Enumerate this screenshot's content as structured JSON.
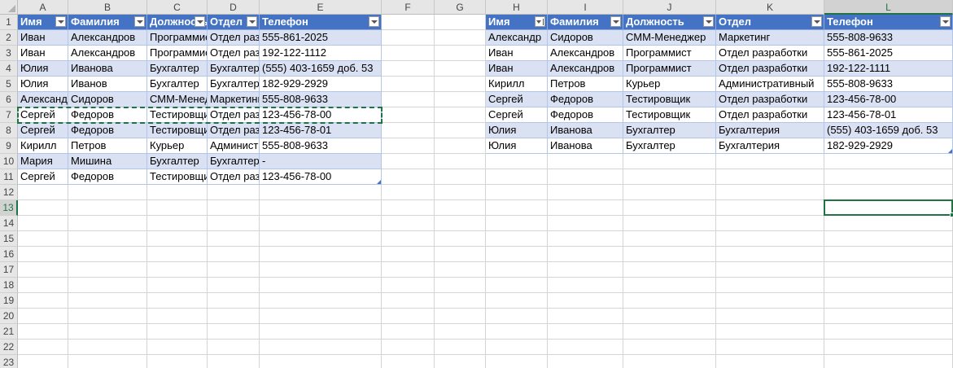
{
  "columns": [
    "A",
    "B",
    "C",
    "D",
    "E",
    "F",
    "G",
    "H",
    "I",
    "J",
    "K",
    "L"
  ],
  "rows": [
    "1",
    "2",
    "3",
    "4",
    "5",
    "6",
    "7",
    "8",
    "9",
    "10",
    "11",
    "12",
    "13",
    "14",
    "15",
    "16",
    "17",
    "18",
    "19",
    "20",
    "21",
    "22",
    "23"
  ],
  "selected_column": "L",
  "selected_row": "13",
  "selected_cell": "L13",
  "copied_range": "A7:E7",
  "table1": {
    "headers": [
      "Имя",
      "Фамилия",
      "Должность",
      "Отдел",
      "Телефон"
    ],
    "rows": [
      [
        "Иван",
        "Александров",
        "Программист",
        "Отдел разработки",
        "555-861-2025"
      ],
      [
        "Иван",
        "Александров",
        "Программист",
        "Отдел разработки",
        "192-122-1112"
      ],
      [
        "Юлия",
        "Иванова",
        "Бухгалтер",
        "Бухгалтерия",
        "(555) 403-1659 доб. 53"
      ],
      [
        "Юлия",
        "Иванов",
        "Бухгалтер",
        "Бухгалтерия",
        "182-929-2929"
      ],
      [
        "Александр",
        "Сидоров",
        "СММ-Менеджер",
        "Маркетинг",
        "555-808-9633"
      ],
      [
        "Сергей",
        "Федоров",
        "Тестировщик",
        "Отдел разработки",
        "123-456-78-00"
      ],
      [
        "Сергей",
        "Федоров",
        "Тестировщик",
        "Отдел разработки",
        "123-456-78-01"
      ],
      [
        "Кирилл",
        "Петров",
        "Курьер",
        "Административный",
        "555-808-9633"
      ],
      [
        "Мария",
        "Мишина",
        "Бухгалтер",
        "Бухгалтерия",
        "-"
      ],
      [
        "Сергей",
        "Федоров",
        "Тестировщик",
        "Отдел разработки",
        "123-456-78-00"
      ]
    ]
  },
  "table2": {
    "headers": [
      "Имя",
      "Фамилия",
      "Должность",
      "Отдел",
      "Телефон"
    ],
    "sorted_column": "Имя",
    "rows": [
      [
        "Александр",
        "Сидоров",
        "СММ-Менеджер",
        "Маркетинг",
        "555-808-9633"
      ],
      [
        "Иван",
        "Александров",
        "Программист",
        "Отдел разработки",
        "555-861-2025"
      ],
      [
        "Иван",
        "Александров",
        "Программист",
        "Отдел разработки",
        "192-122-1111"
      ],
      [
        "Кирилл",
        "Петров",
        "Курьер",
        "Административный",
        "555-808-9633"
      ],
      [
        "Сергей",
        "Федоров",
        "Тестировщик",
        "Отдел разработки",
        "123-456-78-00"
      ],
      [
        "Сергей",
        "Федоров",
        "Тестировщик",
        "Отдел разработки",
        "123-456-78-01"
      ],
      [
        "Юлия",
        "Иванова",
        "Бухгалтер",
        "Бухгалтерия",
        "(555) 403-1659 доб. 53"
      ],
      [
        "Юлия",
        "Иванова",
        "Бухгалтер",
        "Бухгалтерия",
        "182-929-2929"
      ]
    ]
  },
  "colors": {
    "header_fill": "#4472c4",
    "band_fill": "#d9e1f2",
    "selection": "#217346"
  }
}
